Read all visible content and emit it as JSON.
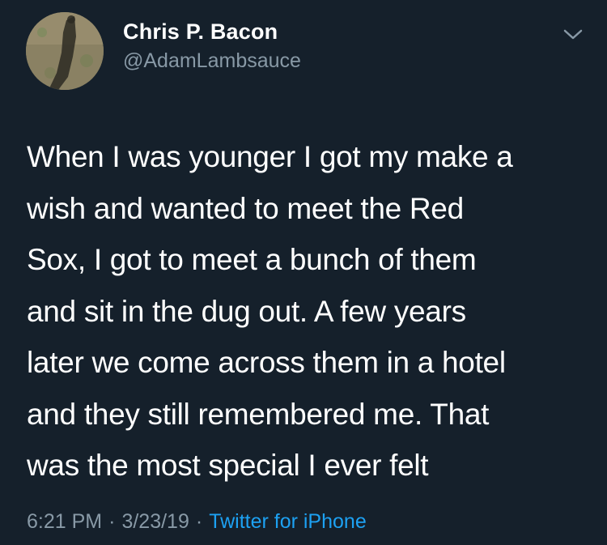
{
  "author": {
    "display_name": "Chris P. Bacon",
    "handle": "@AdamLambsauce"
  },
  "tweet": {
    "text_lines": [
      "When I was younger I got my make a",
      "wish and wanted to meet the Red",
      "Sox, I got to meet a bunch of them",
      "and sit in the dug out. A few years",
      "later we come across them in a hotel",
      "and they still remembered me. That",
      "was the most special I ever felt"
    ],
    "time": "6:21 PM",
    "date": "3/23/19",
    "separator": "·",
    "source": "Twitter for iPhone"
  },
  "colors": {
    "background": "#15202b",
    "primary_text": "#ffffff",
    "secondary_text": "#8899a6",
    "link": "#1da1f2"
  },
  "icons": {
    "menu": "chevron-down-icon"
  }
}
